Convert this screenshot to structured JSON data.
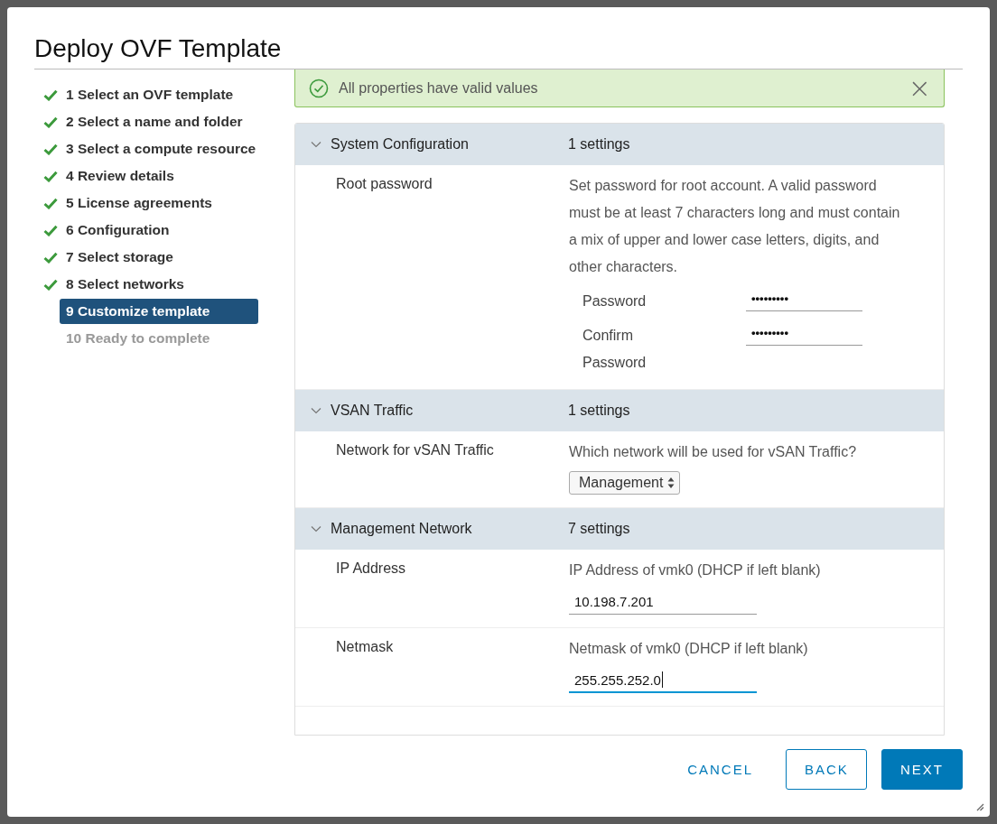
{
  "window": {
    "title": "Deploy OVF Template"
  },
  "steps": [
    {
      "label": "1 Select an OVF template",
      "completed": true,
      "selected": false,
      "disabled": false
    },
    {
      "label": "2 Select a name and folder",
      "completed": true,
      "selected": false,
      "disabled": false
    },
    {
      "label": "3 Select a compute resource",
      "completed": true,
      "selected": false,
      "disabled": false
    },
    {
      "label": "4 Review details",
      "completed": true,
      "selected": false,
      "disabled": false
    },
    {
      "label": "5 License agreements",
      "completed": true,
      "selected": false,
      "disabled": false
    },
    {
      "label": "6 Configuration",
      "completed": true,
      "selected": false,
      "disabled": false
    },
    {
      "label": "7 Select storage",
      "completed": true,
      "selected": false,
      "disabled": false
    },
    {
      "label": "8 Select networks",
      "completed": true,
      "selected": false,
      "disabled": false
    },
    {
      "label": "9 Customize template",
      "completed": false,
      "selected": true,
      "disabled": false
    },
    {
      "label": "10 Ready to complete",
      "completed": false,
      "selected": false,
      "disabled": true
    }
  ],
  "alert": {
    "kind": "success",
    "text": "All properties have valid values",
    "close": "×"
  },
  "sections": [
    {
      "title": "System Configuration",
      "count": "1 settings",
      "expanded": true,
      "properties": [
        {
          "label": "Root password",
          "description": "Set password for root account. A valid password must be at least 7 characters long and must contain a mix of upper and lower case letters, digits, and other characters.",
          "controls": [
            {
              "kind": "password",
              "label": "Password",
              "value": "•••••••••",
              "focused": false
            },
            {
              "kind": "password",
              "label": "Confirm Password",
              "value": "•••••••••",
              "focused": false
            }
          ]
        }
      ]
    },
    {
      "title": "VSAN Traffic",
      "count": "1 settings",
      "expanded": true,
      "properties": [
        {
          "label": "Network for vSAN Traffic",
          "description": "Which network will be used for vSAN Traffic?",
          "controls": [
            {
              "kind": "select",
              "value": "Management"
            }
          ]
        }
      ]
    },
    {
      "title": "Management Network",
      "count": "7 settings",
      "expanded": true,
      "properties": [
        {
          "label": "IP Address",
          "description": "IP Address of vmk0 (DHCP if left blank)",
          "controls": [
            {
              "kind": "text",
              "value": "10.198.7.201",
              "focused": false
            }
          ]
        },
        {
          "label": "Netmask",
          "description": "Netmask of vmk0 (DHCP if left blank)",
          "controls": [
            {
              "kind": "text",
              "value": "255.255.252.0",
              "focused": true
            }
          ]
        }
      ]
    }
  ],
  "buttons": [
    {
      "kind": "flat",
      "label": "CANCEL"
    },
    {
      "kind": "outline",
      "label": "BACK"
    },
    {
      "kind": "primary",
      "label": "NEXT"
    }
  ]
}
